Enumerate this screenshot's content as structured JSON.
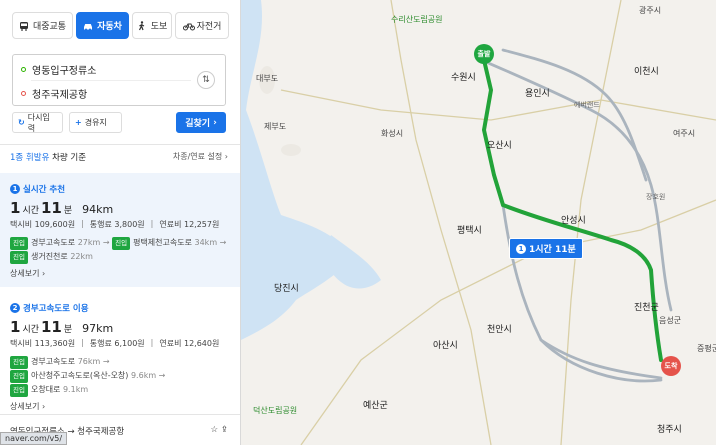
{
  "tabs": [
    {
      "label": "대중교통",
      "icon": "bus-icon"
    },
    {
      "label": "자동차",
      "icon": "car-icon"
    },
    {
      "label": "도보",
      "icon": "walk-icon"
    },
    {
      "label": "자전거",
      "icon": "bike-icon"
    }
  ],
  "route": {
    "origin": "영동입구정류소",
    "destination": "청주국제공항"
  },
  "actions": {
    "reset": "다시입력",
    "waypoint": "경유지",
    "search": "길찾기"
  },
  "condition": {
    "fuel": "1종 휘발유",
    "basis": "차량 기준",
    "settings": "차종/연료 설정"
  },
  "routes": [
    {
      "num": "1",
      "title": "실시간 추천",
      "hours": "1",
      "hour_unit": "시간",
      "mins": "11",
      "min_unit": "분",
      "distance": "94km",
      "taxi": "택시비 109,600원",
      "toll": "통행료 3,800원",
      "fuel": "연료비 12,257원",
      "roads": [
        {
          "tag": "진입",
          "name": "경부고속도로",
          "dist": "27km"
        },
        {
          "tag": "진입",
          "name": "평택제천고속도로",
          "dist": "34km"
        },
        {
          "tag": "진입",
          "name": "생거진천로",
          "dist": "22km"
        }
      ],
      "more": "상세보기"
    },
    {
      "num": "2",
      "title": "경부고속도로 이용",
      "hours": "1",
      "hour_unit": "시간",
      "mins": "11",
      "min_unit": "분",
      "distance": "97km",
      "taxi": "택시비 113,360원",
      "toll": "통행료 6,100원",
      "fuel": "연료비 12,640원",
      "roads": [
        {
          "tag": "진입",
          "name": "경부고속도로",
          "dist": "76km"
        },
        {
          "tag": "진입",
          "name": "아산청주고속도로(옥산-오창)",
          "dist": "9.6km"
        },
        {
          "tag": "진입",
          "name": "오창대로",
          "dist": "9.1km"
        }
      ],
      "more": "상세보기"
    }
  ],
  "footer": {
    "origin": "영동입구정류소",
    "destination": "청주국제공항",
    "url": "naver.com/v5/"
  },
  "map": {
    "badge_num": "1",
    "badge_time": "1시간 11분",
    "start": "출발",
    "end": "도착",
    "places": [
      {
        "name": "수원시",
        "cls": "big"
      },
      {
        "name": "오산시",
        "cls": "big"
      },
      {
        "name": "평택시",
        "cls": "big"
      },
      {
        "name": "안성시",
        "cls": "big"
      },
      {
        "name": "이천시",
        "cls": "big"
      },
      {
        "name": "용인시",
        "cls": "big"
      },
      {
        "name": "진천군",
        "cls": "big"
      },
      {
        "name": "천안시",
        "cls": "big"
      },
      {
        "name": "아산시",
        "cls": "big"
      },
      {
        "name": "당진시",
        "cls": "big"
      },
      {
        "name": "예산군",
        "cls": "big"
      },
      {
        "name": "청주시",
        "cls": "big"
      },
      {
        "name": "화성시",
        "cls": ""
      },
      {
        "name": "제부도",
        "cls": ""
      },
      {
        "name": "대부도",
        "cls": ""
      },
      {
        "name": "광주시",
        "cls": ""
      },
      {
        "name": "여주시",
        "cls": ""
      },
      {
        "name": "음성군",
        "cls": ""
      },
      {
        "name": "증평군",
        "cls": ""
      },
      {
        "name": "장호원",
        "cls": "small"
      },
      {
        "name": "수리산도립공원",
        "cls": "green"
      },
      {
        "name": "덕산도립공원",
        "cls": "green"
      },
      {
        "name": "에버랜드",
        "cls": "small"
      }
    ]
  }
}
